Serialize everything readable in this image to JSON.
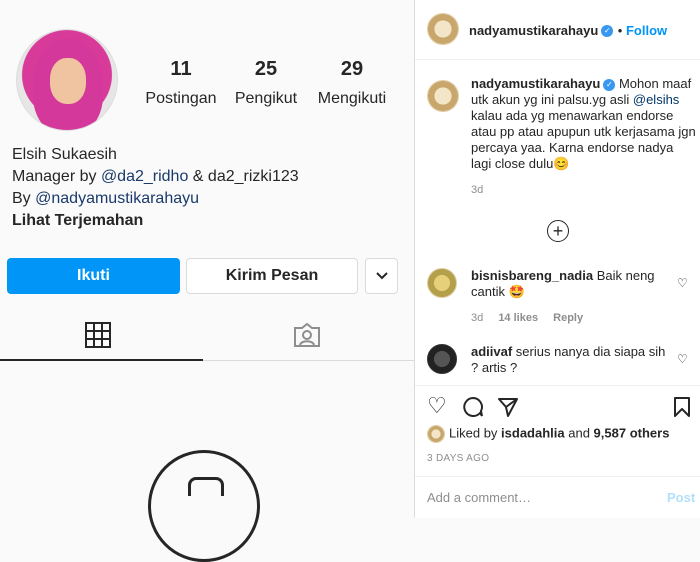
{
  "profile": {
    "stats": [
      {
        "num": "11",
        "label": "Postingan"
      },
      {
        "num": "25",
        "label": "Pengikut"
      },
      {
        "num": "29",
        "label": "Mengikuti"
      }
    ],
    "name": "Elsih Sukaesih",
    "bio_line1_prefix": "Manager by ",
    "bio_line1_mention": "@da2_ridho",
    "bio_line1_suffix": " & da2_rizki123",
    "bio_line2_prefix": "By ",
    "bio_line2_mention": "@nadyamustikarahayu",
    "translate": "Lihat Terjemahan",
    "follow_label": "Ikuti",
    "message_label": "Kirim Pesan"
  },
  "post": {
    "username": "nadyamustikarahayu",
    "follow_label": "Follow",
    "caption_user": "nadyamustikarahayu",
    "caption_part1": " Mohon maaf utk akun yg ini palsu.yg asli ",
    "caption_mention": "@elsihs",
    "caption_part2": " kalau ada yg menawarkan endorse atau pp atau apupun utk kerjasama jgn percaya yaa. Karna endorse nadya lagi close dulu😊",
    "caption_time": "3d",
    "comments": [
      {
        "user": "bisnisbareng_nadia",
        "text": " Baik neng cantik 🤩",
        "time": "3d",
        "likes": "14 likes",
        "reply": "Reply"
      },
      {
        "user": "adiivaf",
        "text": " serius nanya dia siapa sih ? artis ?"
      }
    ],
    "liked_by_prefix": "Liked by ",
    "liked_by_user": "isdadahlia",
    "liked_by_suffix": " and ",
    "liked_count": "9,587 others",
    "days_ago": "3 DAYS AGO",
    "add_comment_placeholder": "Add a comment…",
    "post_label": "Post"
  }
}
